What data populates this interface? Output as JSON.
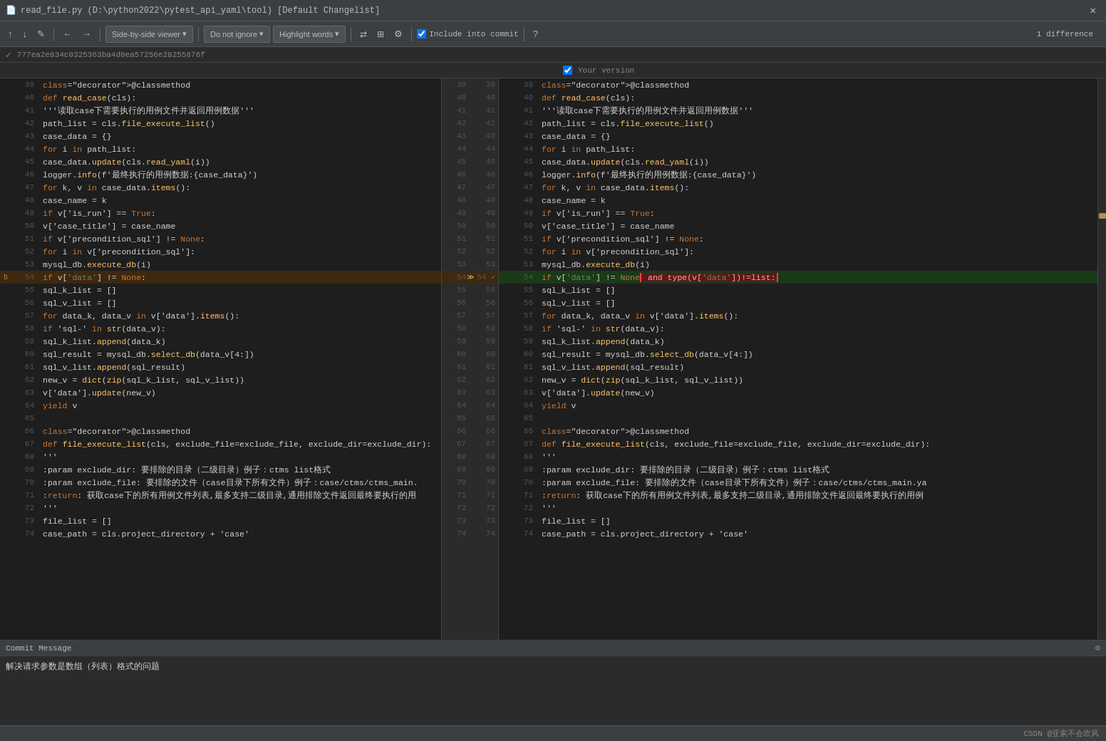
{
  "titlebar": {
    "title": "read_file.py (D:\\python2022\\pytest_api_yaml\\tool) [Default Changelist]",
    "close_label": "✕"
  },
  "toolbar": {
    "prev_label": "↑",
    "next_label": "↓",
    "edit_label": "✎",
    "back_label": "←",
    "forward_label": "→",
    "viewer_label": "Side-by-side viewer",
    "viewer_dropdown": "▾",
    "ignore_label": "Do not ignore",
    "ignore_dropdown": "▾",
    "highlight_label": "Highlight words",
    "highlight_dropdown": "▾",
    "settings_icon": "⚙",
    "layout_icon": "⊞",
    "gear_icon": "⚙",
    "include_label": "Include into commit",
    "help_label": "?",
    "diff_count": "1 difference",
    "your_version_label": "Your version"
  },
  "hash_bar": {
    "check": "✓",
    "hash": "777ea2e834c0325363ba4d0ea57256e28255876f"
  },
  "left_lines": [
    {
      "num": 39,
      "content": "@classmethod",
      "type": "normal"
    },
    {
      "num": 40,
      "content": "    def read_case(cls):",
      "type": "normal"
    },
    {
      "num": 41,
      "content": "        '''读取case下需要执行的用例文件并返回用例数据'''",
      "type": "normal"
    },
    {
      "num": 42,
      "content": "        path_list = cls.file_execute_list()",
      "type": "normal"
    },
    {
      "num": 43,
      "content": "        case_data = {}",
      "type": "normal"
    },
    {
      "num": 44,
      "content": "        for i in path_list:",
      "type": "normal"
    },
    {
      "num": 45,
      "content": "            case_data.update(cls.read_yaml(i))",
      "type": "normal"
    },
    {
      "num": 46,
      "content": "        logger.info(f'最终执行的用例数据:{case_data}')",
      "type": "normal"
    },
    {
      "num": 47,
      "content": "        for k, v in case_data.items():",
      "type": "normal"
    },
    {
      "num": 48,
      "content": "            case_name = k",
      "type": "normal"
    },
    {
      "num": 49,
      "content": "            if v['is_run'] == True:",
      "type": "normal"
    },
    {
      "num": 50,
      "content": "                v['case_title'] = case_name",
      "type": "normal"
    },
    {
      "num": 51,
      "content": "                if v['precondition_sql'] != None:",
      "type": "normal"
    },
    {
      "num": 52,
      "content": "                    for i in v['precondition_sql']:",
      "type": "normal"
    },
    {
      "num": 53,
      "content": "                        mysql_db.execute_db(i)",
      "type": "normal"
    },
    {
      "num": 54,
      "content": "                if v['data'] != None:",
      "type": "changed"
    },
    {
      "num": 55,
      "content": "                    sql_k_list = []",
      "type": "normal"
    },
    {
      "num": 56,
      "content": "                    sql_v_list = []",
      "type": "normal"
    },
    {
      "num": 57,
      "content": "                    for data_k, data_v in v['data'].items():",
      "type": "normal"
    },
    {
      "num": 58,
      "content": "                        if 'sql-' in str(data_v):",
      "type": "normal"
    },
    {
      "num": 59,
      "content": "                            sql_k_list.append(data_k)",
      "type": "normal"
    },
    {
      "num": 60,
      "content": "                            sql_result = mysql_db.select_db(data_v[4:])",
      "type": "normal"
    },
    {
      "num": 61,
      "content": "                            sql_v_list.append(sql_result)",
      "type": "normal"
    },
    {
      "num": 62,
      "content": "                    new_v = dict(zip(sql_k_list, sql_v_list))",
      "type": "normal"
    },
    {
      "num": 63,
      "content": "                    v['data'].update(new_v)",
      "type": "normal"
    },
    {
      "num": 64,
      "content": "                yield v",
      "type": "normal"
    },
    {
      "num": 65,
      "content": "",
      "type": "normal"
    },
    {
      "num": 66,
      "content": "@classmethod",
      "type": "normal"
    },
    {
      "num": 67,
      "content": "    def file_execute_list(cls, exclude_file=exclude_file, exclude_dir=exclude_dir):",
      "type": "normal"
    },
    {
      "num": 68,
      "content": "        '''",
      "type": "normal"
    },
    {
      "num": 69,
      "content": "        :param exclude_dir: 要排除的目录（二级目录）例子：ctms  list格式",
      "type": "normal"
    },
    {
      "num": 70,
      "content": "        :param exclude_file: 要排除的文件（case目录下所有文件）例子：case/ctms/ctms_main.",
      "type": "normal"
    },
    {
      "num": 71,
      "content": "        :return: 获取case下的所有用例文件列表,最多支持二级目录,通用排除文件返回最终要执行的用",
      "type": "normal"
    },
    {
      "num": 72,
      "content": "        '''",
      "type": "normal"
    },
    {
      "num": 73,
      "content": "        file_list = []",
      "type": "normal"
    },
    {
      "num": 74,
      "content": "        case_path = cls.project_directory + 'case'",
      "type": "normal"
    }
  ],
  "right_lines": [
    {
      "num": 39,
      "content": "@classmethod",
      "type": "normal"
    },
    {
      "num": 40,
      "content": "    def read_case(cls):",
      "type": "normal"
    },
    {
      "num": 41,
      "content": "        '''读取case下需要执行的用例文件并返回用例数据'''",
      "type": "normal"
    },
    {
      "num": 42,
      "content": "        path_list = cls.file_execute_list()",
      "type": "normal"
    },
    {
      "num": 43,
      "content": "        case_data = {}",
      "type": "normal"
    },
    {
      "num": 44,
      "content": "        for i in path_list:",
      "type": "normal"
    },
    {
      "num": 45,
      "content": "            case_data.update(cls.read_yaml(i))",
      "type": "normal"
    },
    {
      "num": 46,
      "content": "        logger.info(f'最终执行的用例数据:{case_data}')",
      "type": "normal"
    },
    {
      "num": 47,
      "content": "        for k, v in case_data.items():",
      "type": "normal"
    },
    {
      "num": 48,
      "content": "            case_name = k",
      "type": "normal"
    },
    {
      "num": 49,
      "content": "            if v['is_run'] == True:",
      "type": "normal"
    },
    {
      "num": 50,
      "content": "                v['case_title'] = case_name",
      "type": "normal"
    },
    {
      "num": 51,
      "content": "                if v['precondition_sql'] != None:",
      "type": "normal"
    },
    {
      "num": 52,
      "content": "                    for i in v['precondition_sql']:",
      "type": "normal"
    },
    {
      "num": 53,
      "content": "                        mysql_db.execute_db(i)",
      "type": "normal"
    },
    {
      "num": 54,
      "content": "                if v['data'] != None and type(v['data'])!=list:",
      "type": "changed"
    },
    {
      "num": 55,
      "content": "                    sql_k_list = []",
      "type": "normal"
    },
    {
      "num": 56,
      "content": "                    sql_v_list = []",
      "type": "normal"
    },
    {
      "num": 57,
      "content": "                    for data_k, data_v in v['data'].items():",
      "type": "normal"
    },
    {
      "num": 58,
      "content": "                        if 'sql-' in str(data_v):",
      "type": "normal"
    },
    {
      "num": 59,
      "content": "                            sql_k_list.append(data_k)",
      "type": "normal"
    },
    {
      "num": 60,
      "content": "                            sql_result = mysql_db.select_db(data_v[4:])",
      "type": "normal"
    },
    {
      "num": 61,
      "content": "                            sql_v_list.append(sql_result)",
      "type": "normal"
    },
    {
      "num": 62,
      "content": "                    new_v = dict(zip(sql_k_list, sql_v_list))",
      "type": "normal"
    },
    {
      "num": 63,
      "content": "                    v['data'].update(new_v)",
      "type": "normal"
    },
    {
      "num": 64,
      "content": "                yield v",
      "type": "normal"
    },
    {
      "num": 65,
      "content": "",
      "type": "normal"
    },
    {
      "num": 66,
      "content": "@classmethod",
      "type": "normal"
    },
    {
      "num": 67,
      "content": "    def file_execute_list(cls, exclude_file=exclude_file, exclude_dir=exclude_dir):",
      "type": "normal"
    },
    {
      "num": 68,
      "content": "        '''",
      "type": "normal"
    },
    {
      "num": 69,
      "content": "        :param exclude_dir: 要排除的目录（二级目录）例子：ctms  list格式",
      "type": "normal"
    },
    {
      "num": 70,
      "content": "        :param exclude_file: 要排除的文件（case目录下所有文件）例子：case/ctms/ctms_main.ya",
      "type": "normal"
    },
    {
      "num": 71,
      "content": "        :return: 获取case下的所有用例文件列表,最多支持二级目录,通用排除文件返回最终要执行的用例",
      "type": "normal"
    },
    {
      "num": 72,
      "content": "        '''",
      "type": "normal"
    },
    {
      "num": 73,
      "content": "        file_list = []",
      "type": "normal"
    },
    {
      "num": 74,
      "content": "        case_path = cls.project_directory + 'case'",
      "type": "normal"
    }
  ],
  "commit": {
    "header": "Commit Message",
    "message": "解决请求参数是数组（列表）格式的问题",
    "settings_icon": "⚙"
  },
  "bottom": {
    "brand": "CSDN @亚索不会吹风"
  }
}
